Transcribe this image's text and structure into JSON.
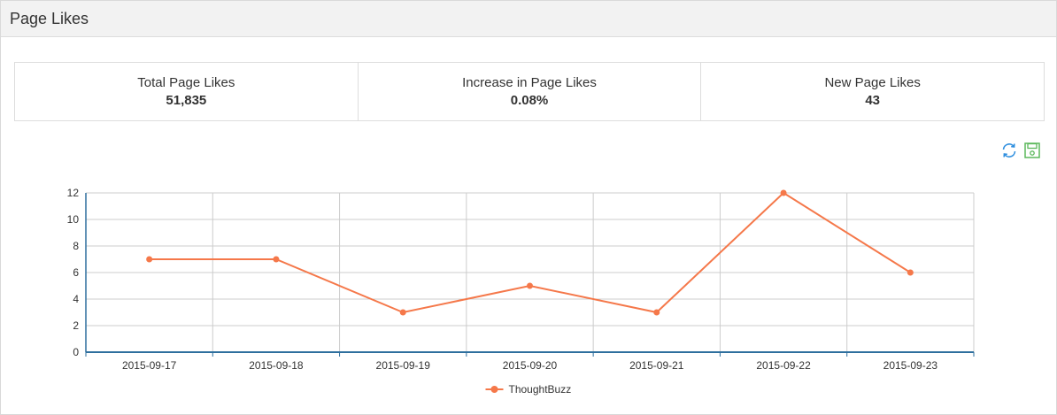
{
  "panel": {
    "title": "Page Likes"
  },
  "stats": [
    {
      "label": "Total Page Likes",
      "value": "51,835"
    },
    {
      "label": "Increase in Page Likes",
      "value": "0.08%"
    },
    {
      "label": "New Page Likes",
      "value": "43"
    }
  ],
  "toolbar": {
    "refresh_icon": "refresh-icon",
    "save_icon": "save-icon",
    "refresh_color": "#2f8fdf",
    "save_color": "#5cb85c"
  },
  "chart_data": {
    "type": "line",
    "categories": [
      "2015-09-17",
      "2015-09-18",
      "2015-09-19",
      "2015-09-20",
      "2015-09-21",
      "2015-09-22",
      "2015-09-23"
    ],
    "series": [
      {
        "name": "ThoughtBuzz",
        "values": [
          7,
          7,
          3,
          5,
          3,
          12,
          6
        ],
        "color": "#f5784a"
      }
    ],
    "ylim": [
      0,
      12
    ],
    "yticks": [
      0,
      2,
      4,
      6,
      8,
      10,
      12
    ],
    "grid": true,
    "legend": "bottom-center",
    "axis_color": "#2e6f9e"
  }
}
